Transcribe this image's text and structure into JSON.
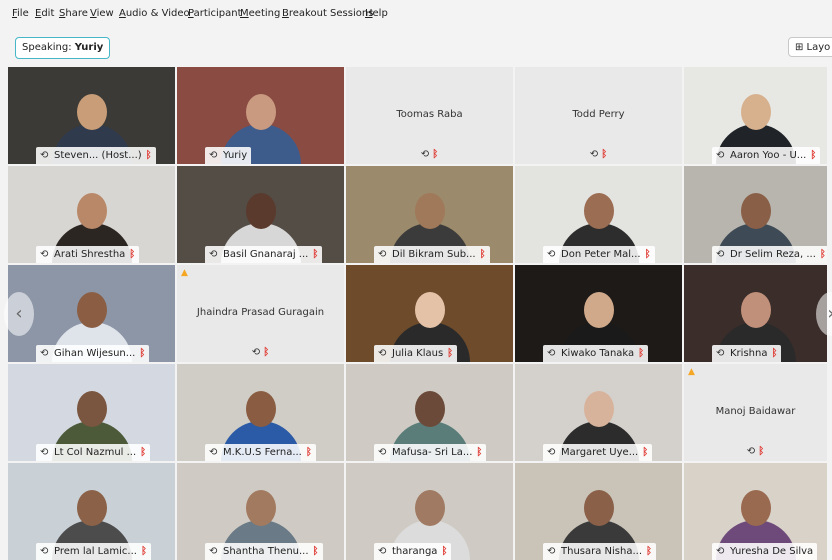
{
  "menu": [
    "File",
    "Edit",
    "Share",
    "View",
    "Audio & Video",
    "Participant",
    "Meeting",
    "Breakout Sessions",
    "Help"
  ],
  "menu_accel": [
    "F",
    "E",
    "S",
    "V",
    "A",
    "P",
    "M",
    "B",
    "H"
  ],
  "menu_rest": [
    "ile",
    "dit",
    "hare",
    "iew",
    "udio & Video",
    "articipant",
    "eeting",
    "reakout Sessions",
    "elp"
  ],
  "speaking": {
    "prefix": "Speaking:",
    "name": "Yuriy"
  },
  "layout_button": "⊞ Layo",
  "accent": "#2fb6e9",
  "muted_color": "#e0413a",
  "participants": [
    {
      "name": "Steven... (Host...)",
      "video": true
    },
    {
      "name": "Yuriy",
      "video": true,
      "active": true
    },
    {
      "name": "Toomas Raba",
      "video": false
    },
    {
      "name": "Todd Perry",
      "video": false
    },
    {
      "name": "Aaron Yoo - U...",
      "video": true
    },
    {
      "name": "Arati Shrestha",
      "video": true
    },
    {
      "name": "Basil Gnanaraj ...",
      "video": true
    },
    {
      "name": "Dil Bikram Sub...",
      "video": true
    },
    {
      "name": "Don Peter Mal...",
      "video": true
    },
    {
      "name": "Dr Selim Reza, ...",
      "video": true
    },
    {
      "name": "Gihan Wijesun...",
      "video": true
    },
    {
      "name": "Jhaindra Prasad Guragain",
      "video": false
    },
    {
      "name": "Julia Klaus",
      "video": true
    },
    {
      "name": "Kiwako Tanaka",
      "video": true
    },
    {
      "name": "Krishna",
      "video": true
    },
    {
      "name": "Lt Col Nazmul ...",
      "video": true
    },
    {
      "name": "M.K.U.S Ferna...",
      "video": true
    },
    {
      "name": "Mafusa- Sri La...",
      "video": true
    },
    {
      "name": "Margaret Uye...",
      "video": true
    },
    {
      "name": "Manoj Baidawar",
      "video": false
    },
    {
      "name": "Prem lal Lamic...",
      "video": true
    },
    {
      "name": "Shantha Thenu...",
      "video": true
    },
    {
      "name": "tharanga",
      "video": true
    },
    {
      "name": "Thusara Nisha...",
      "video": true
    },
    {
      "name": "Yuresha De Silva",
      "video": true
    }
  ]
}
